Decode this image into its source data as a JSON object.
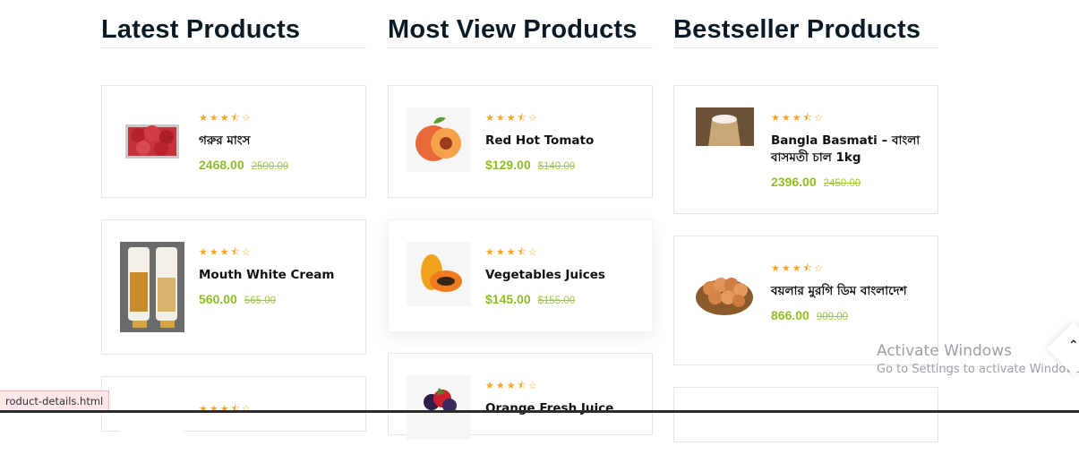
{
  "columns": [
    {
      "title": "Latest Products",
      "products": [
        {
          "name": "গরুর মাংস",
          "price": "2468.00",
          "old_price": "2500.00",
          "rating": 3.5,
          "image": "meat-image"
        },
        {
          "name": "Mouth White Cream",
          "price": "560.00",
          "old_price": "565.00",
          "rating": 3.5,
          "image": "cream-tubes-image"
        },
        {
          "name": "",
          "price": "",
          "old_price": "",
          "rating": 3.5,
          "image": "product-image"
        }
      ]
    },
    {
      "title": "Most View Products",
      "products": [
        {
          "name": "Red Hot Tomato",
          "price": "$129.00",
          "old_price": "$140.00",
          "rating": 3.5,
          "image": "peach-image"
        },
        {
          "name": "Vegetables Juices",
          "price": "$145.00",
          "old_price": "$155.00",
          "rating": 3.5,
          "image": "papaya-image"
        },
        {
          "name": "Orange Fresh Juice",
          "price": "",
          "old_price": "",
          "rating": 3.5,
          "image": "berries-image"
        }
      ]
    },
    {
      "title": "Bestseller Products",
      "products": [
        {
          "name": "Bangla Basmati – বাংলা বাসমতী চাল 1kg",
          "price": "2396.00",
          "old_price": "2450.00",
          "rating": 3.5,
          "image": "rice-sack-image"
        },
        {
          "name": "বয়লার মুরগি ডিম বাংলাদেশ",
          "price": "866.00",
          "old_price": "909.00",
          "rating": 3.5,
          "image": "eggs-basket-image"
        }
      ]
    }
  ],
  "status_bar_url": "roduct-details.html",
  "watermark": {
    "line1": "Activate Windows",
    "line2": "Go to Settings to activate Windows."
  },
  "colors": {
    "price": "#8fbf21",
    "star": "#f5a623",
    "title": "#0b1b26"
  },
  "icons": {
    "star_full": "★",
    "star_half": "⯪",
    "star_empty": "☆",
    "scroll_top": "⌃"
  }
}
